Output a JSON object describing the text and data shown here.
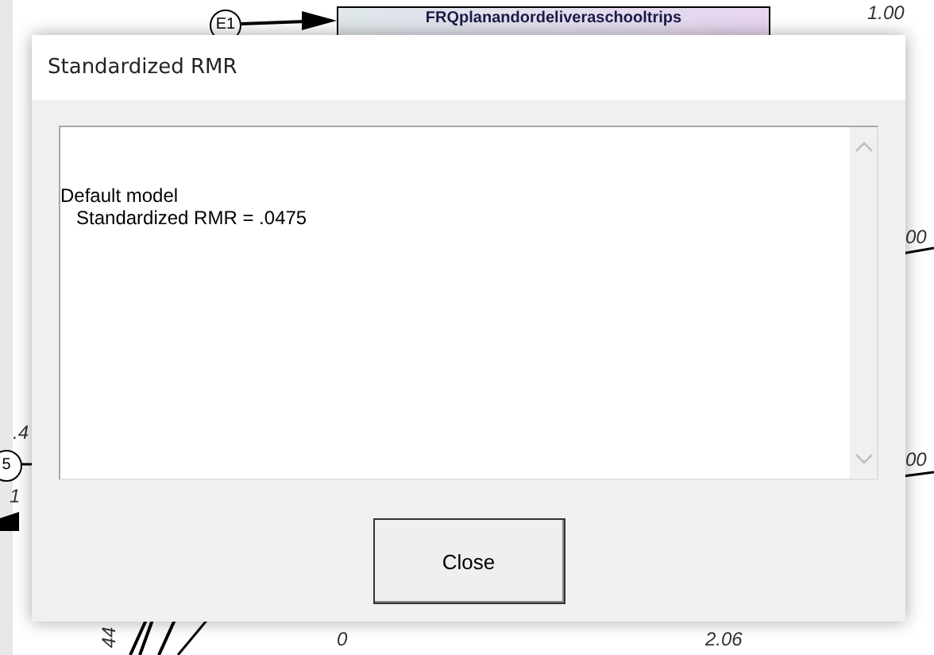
{
  "diagram": {
    "observed_variable": "FRQplanandordeliveraschooltrips",
    "error_variables": [
      "E1",
      "5"
    ],
    "labels": [
      "1.00",
      ".4",
      "1",
      "00",
      "00",
      "44",
      "0",
      "2.06"
    ]
  },
  "dialog": {
    "title": "Standardized RMR",
    "output_lines": [
      "Default model",
      "   Standardized RMR = .0475"
    ],
    "buttons": [
      "Close"
    ]
  }
}
